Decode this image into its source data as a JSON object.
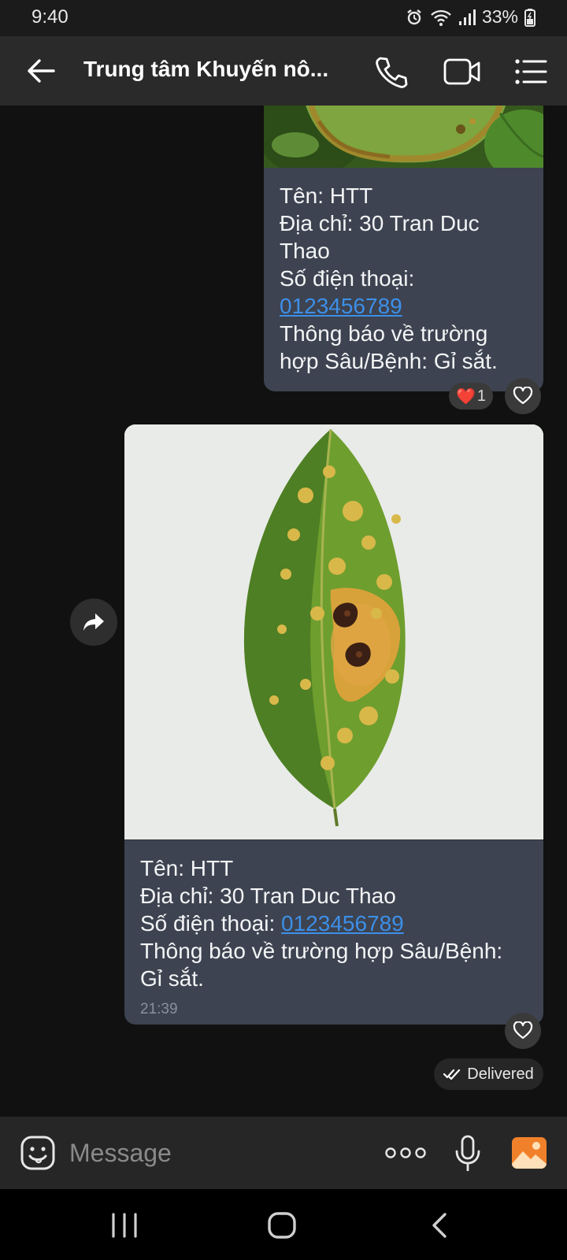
{
  "status_bar": {
    "time": "9:40",
    "battery": "33%",
    "icons": [
      "alarm-icon",
      "wifi-icon",
      "signal-icon",
      "battery-icon"
    ]
  },
  "header": {
    "title": "Trung tâm Khuyến nô...",
    "buttons": [
      "back-arrow-icon",
      "phone-icon",
      "video-camera-icon",
      "list-menu-icon"
    ]
  },
  "messages": [
    {
      "name_line": "Tên: HTT",
      "address_line1": "Địa chỉ: 30 Tran Duc",
      "address_line2": "Thao",
      "phone_label": "Số điện thoại:",
      "phone_number": "0123456789",
      "report_line1": "Thông báo về trường",
      "report_line2": "hợp Sâu/Bệnh: Gỉ sắt.",
      "reaction": {
        "emoji": "❤️",
        "count": "1"
      }
    },
    {
      "name_line": "Tên: HTT",
      "address_line1": "Địa chỉ: 30 Tran Duc Thao",
      "phone_label": "Số điện thoại:",
      "phone_number": "0123456789",
      "report_line1": "Thông báo về trường hợp Sâu/Bệnh:",
      "report_line2": "Gỉ sắt.",
      "time": "21:39"
    }
  ],
  "delivery_status": "Delivered",
  "composer": {
    "placeholder": "Message",
    "buttons": [
      "emoji-icon",
      "more-options-icon",
      "microphone-icon",
      "gallery-icon"
    ]
  },
  "nav_bar": [
    "recents-icon",
    "home-icon",
    "back-icon"
  ],
  "colors": {
    "background": "#111111",
    "header": "#2a2a2a",
    "bubble": "#3d4350",
    "link": "#3d8fe8",
    "gallery_accent": "#f0812a"
  }
}
